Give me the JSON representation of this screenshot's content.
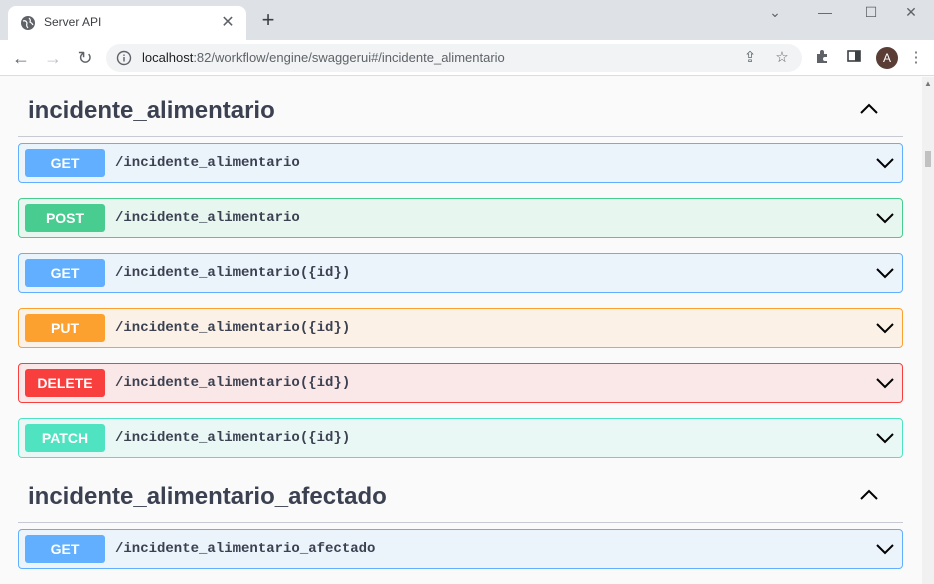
{
  "browser": {
    "tab_title": "Server API",
    "url_host": "localhost",
    "url_path": ":82/workflow/engine/swaggerui#/incidente_alimentario",
    "avatar_letter": "A"
  },
  "sections": [
    {
      "title": "incidente_alimentario",
      "operations": [
        {
          "method": "GET",
          "path": "/incidente_alimentario"
        },
        {
          "method": "POST",
          "path": "/incidente_alimentario"
        },
        {
          "method": "GET",
          "path": "/incidente_alimentario({id})"
        },
        {
          "method": "PUT",
          "path": "/incidente_alimentario({id})"
        },
        {
          "method": "DELETE",
          "path": "/incidente_alimentario({id})"
        },
        {
          "method": "PATCH",
          "path": "/incidente_alimentario({id})"
        }
      ]
    },
    {
      "title": "incidente_alimentario_afectado",
      "operations": [
        {
          "method": "GET",
          "path": "/incidente_alimentario_afectado"
        }
      ]
    }
  ],
  "colors": {
    "get": "#61affe",
    "post": "#49cc90",
    "put": "#fca130",
    "delete": "#f93e3e",
    "patch": "#50e3c2"
  }
}
